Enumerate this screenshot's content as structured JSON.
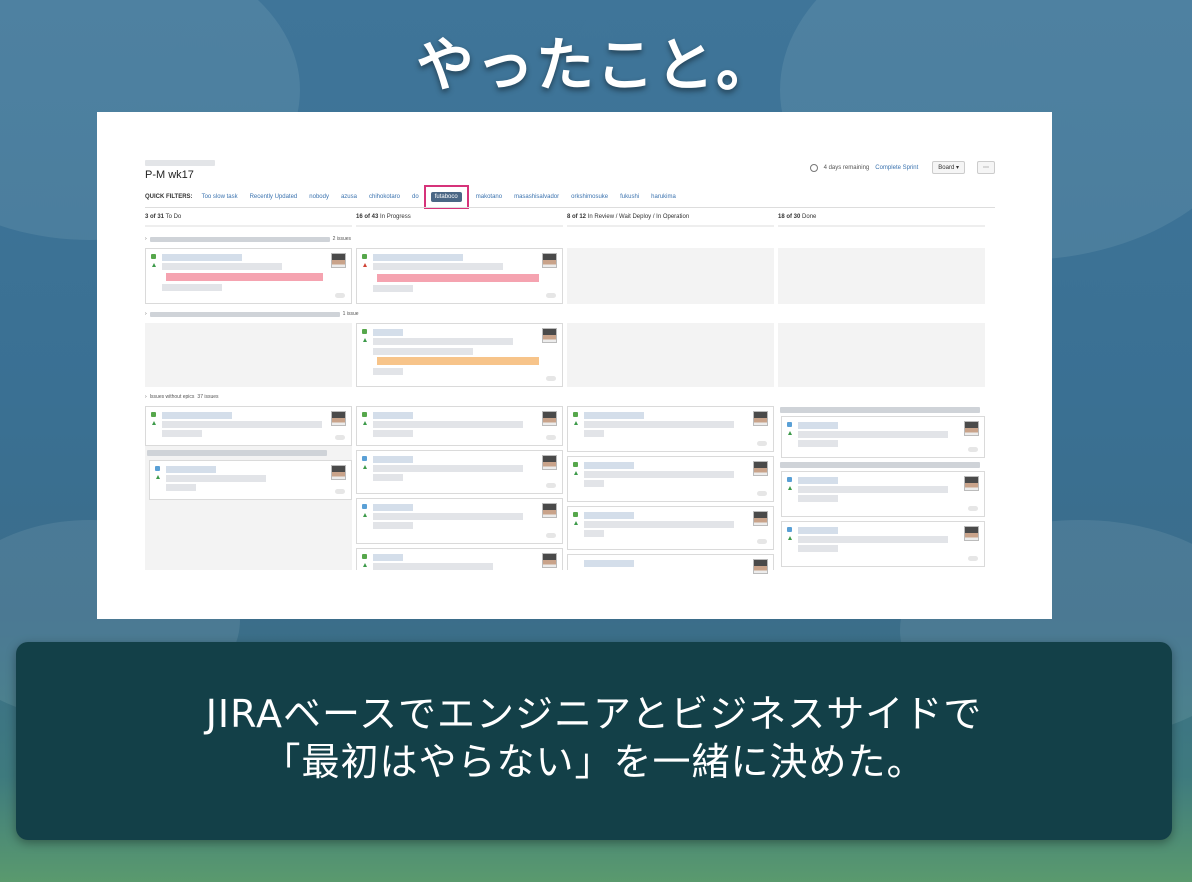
{
  "slide": {
    "title": "やったこと。",
    "caption_line1": "JIRAベースでエンジニアとビジネスサイドで",
    "caption_line2": "「最初はやらない」を一緒に決めた。"
  },
  "board": {
    "sprint_title": "P-M wk17",
    "days_remaining": "4 days remaining",
    "complete_sprint": "Complete Sprint",
    "board_button": "Board ▾",
    "more_button": "⋯",
    "quick_filters_label": "QUICK FILTERS:",
    "quick_filters": [
      "Too slow task",
      "Recently Updated",
      "nobody",
      "azusa",
      "chihokotaro",
      "do",
      "futaboco",
      "makotano",
      "masashisalvador",
      "orkshimosuke",
      "fukushi",
      "harukima"
    ],
    "active_filter": "futaboco",
    "columns": [
      {
        "count": "3 of 31",
        "name": "To Do"
      },
      {
        "count": "16 of 43",
        "name": "In Progress"
      },
      {
        "count": "8 of 12",
        "name": "In Review / Wait Deploy / In Operation"
      },
      {
        "count": "18 of 30",
        "name": "Done"
      }
    ],
    "swimlanes": [
      {
        "label": "",
        "count": "2 issues"
      },
      {
        "label": "",
        "count": "1 issue"
      },
      {
        "label": "Issues without epics",
        "count": "37 issues"
      }
    ]
  },
  "colors": {
    "active_filter_bg": "#4a6785",
    "highlight_box": "#d6337a",
    "caption_box": "#134048",
    "red_highlight": "#f5a3b0",
    "orange_highlight": "#f7c48a"
  },
  "icons": [
    "clock-icon",
    "story-type-icon",
    "task-type-icon",
    "priority-arrow-icon",
    "avatar"
  ]
}
